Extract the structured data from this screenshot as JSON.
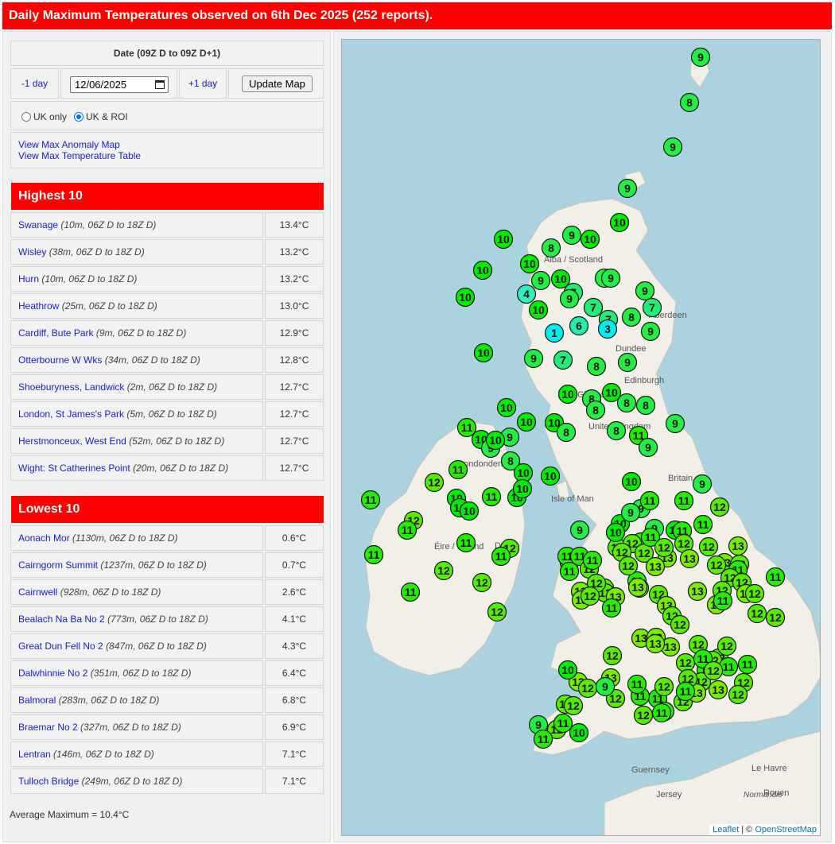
{
  "page_title": "Daily Maximum Temperatures observed on 6th Dec 2025 (252 reports).",
  "controls": {
    "date_header": "Date (09Z D to 09Z D+1)",
    "prev_label": "-1 day",
    "date_value": "12/06/2025",
    "next_label": "+1 day",
    "update_label": "Update Map",
    "uk_only_label": "UK only",
    "uk_roi_label": "UK & ROI",
    "selected_region": "UK & ROI"
  },
  "links": {
    "anomaly": "View Max Anomaly Map",
    "table": "View Max Temperature Table"
  },
  "highest": {
    "title": "Highest 10",
    "rows": [
      {
        "name": "Swanage",
        "detail": "(10m, 06Z D to 18Z D)",
        "value": "13.4°C"
      },
      {
        "name": "Wisley",
        "detail": "(38m, 06Z D to 18Z D)",
        "value": "13.2°C"
      },
      {
        "name": "Hurn",
        "detail": "(10m, 06Z D to 18Z D)",
        "value": "13.2°C"
      },
      {
        "name": "Heathrow",
        "detail": "(25m, 06Z D to 18Z D)",
        "value": "13.0°C"
      },
      {
        "name": "Cardiff, Bute Park",
        "detail": "(9m, 06Z D to 18Z D)",
        "value": "12.9°C"
      },
      {
        "name": "Otterbourne W Wks",
        "detail": "(34m, 06Z D to 18Z D)",
        "value": "12.8°C"
      },
      {
        "name": "Shoeburyness, Landwick",
        "detail": "(2m, 06Z D to 18Z D)",
        "value": "12.7°C"
      },
      {
        "name": "London, St James's Park",
        "detail": "(5m, 06Z D to 18Z D)",
        "value": "12.7°C"
      },
      {
        "name": "Herstmonceux, West End",
        "detail": "(52m, 06Z D to 18Z D)",
        "value": "12.7°C"
      },
      {
        "name": "Wight: St Catherines Point",
        "detail": "(20m, 06Z D to 18Z D)",
        "value": "12.7°C"
      }
    ]
  },
  "lowest": {
    "title": "Lowest 10",
    "rows": [
      {
        "name": "Aonach Mor",
        "detail": "(1130m, 06Z D to 18Z D)",
        "value": "0.6°C"
      },
      {
        "name": "Cairngorm Summit",
        "detail": "(1237m, 06Z D to 18Z D)",
        "value": "0.7°C"
      },
      {
        "name": "Cairnwell",
        "detail": "(928m, 06Z D to 18Z D)",
        "value": "2.6°C"
      },
      {
        "name": "Bealach Na Ba No 2",
        "detail": "(773m, 06Z D to 18Z D)",
        "value": "4.1°C"
      },
      {
        "name": "Great Dun Fell No 2",
        "detail": "(847m, 06Z D to 18Z D)",
        "value": "4.3°C"
      },
      {
        "name": "Dalwhinnie No 2",
        "detail": "(351m, 06Z D to 18Z D)",
        "value": "6.4°C"
      },
      {
        "name": "Balmoral",
        "detail": "(283m, 06Z D to 18Z D)",
        "value": "6.8°C"
      },
      {
        "name": "Braemar No 2",
        "detail": "(327m, 06Z D to 18Z D)",
        "value": "6.9°C"
      },
      {
        "name": "Lentran",
        "detail": "(146m, 06Z D to 18Z D)",
        "value": "7.1°C"
      },
      {
        "name": "Tulloch Bridge",
        "detail": "(249m, 06Z D to 18Z D)",
        "value": "7.1°C"
      }
    ]
  },
  "average": "Average Maximum = 10.4°C",
  "map": {
    "place_labels": [
      "Aberdeen",
      "Dundee",
      "Edinburgh",
      "Glasgow",
      "United Kingdom",
      "Isle of Man",
      "Éire / Ireland",
      "Dublin",
      "Britain",
      "Londonderry",
      "Guernsey",
      "Jersey",
      "Le Havre",
      "Rouen",
      "Normandie",
      "Alba / Scotland"
    ],
    "attribution_leaflet": "Leaflet",
    "attribution_sep": " | © ",
    "attribution_osm": "OpenStreetMap",
    "colors": {
      "sea": "#aad3df",
      "land": "#f2efe9",
      "marker_green": "#00ee00",
      "marker_yellowgreen": "#77ee00",
      "marker_cyan": "#00eeee",
      "marker_teal": "#33eebb"
    },
    "markers": [
      {
        "value": "9",
        "color": "#22ee44"
      },
      {
        "value": "8",
        "color": "#22ee44"
      },
      {
        "value": "9",
        "color": "#22ee44"
      },
      {
        "value": "9",
        "color": "#22ee44"
      },
      {
        "value": "10",
        "color": "#00ee00"
      },
      {
        "value": "10",
        "color": "#00ee00"
      },
      {
        "value": "8",
        "color": "#22ee44"
      },
      {
        "value": "9",
        "color": "#22ee44"
      },
      {
        "value": "10",
        "color": "#00ee00"
      },
      {
        "value": "10",
        "color": "#00ee00"
      },
      {
        "value": "10",
        "color": "#00ee00"
      },
      {
        "value": "10",
        "color": "#00ee00"
      },
      {
        "value": "9",
        "color": "#22ee44"
      },
      {
        "value": "9",
        "color": "#22ee44"
      },
      {
        "value": "4",
        "color": "#33eebb"
      },
      {
        "value": "10",
        "color": "#00ee00"
      },
      {
        "value": "10",
        "color": "#00ee00"
      },
      {
        "value": "9",
        "color": "#22ee44"
      },
      {
        "value": "7",
        "color": "#22ee77"
      },
      {
        "value": "9",
        "color": "#22ee44"
      },
      {
        "value": "9",
        "color": "#22ee44"
      },
      {
        "value": "7",
        "color": "#22ee77"
      },
      {
        "value": "6",
        "color": "#22eeaa"
      },
      {
        "value": "7",
        "color": "#22ee77"
      },
      {
        "value": "7",
        "color": "#22ee77"
      },
      {
        "value": "8",
        "color": "#22ee44"
      },
      {
        "value": "9",
        "color": "#22ee44"
      },
      {
        "value": "8",
        "color": "#22ee44"
      },
      {
        "value": "1",
        "color": "#00eeee"
      },
      {
        "value": "3",
        "color": "#00eeee"
      },
      {
        "value": "10",
        "color": "#00ee00"
      },
      {
        "value": "9",
        "color": "#22ee44"
      },
      {
        "value": "7",
        "color": "#22ee77"
      },
      {
        "value": "8",
        "color": "#22ee44"
      },
      {
        "value": "9",
        "color": "#22ee44"
      },
      {
        "value": "10",
        "color": "#00ee00"
      },
      {
        "value": "8",
        "color": "#22ee44"
      },
      {
        "value": "8",
        "color": "#22ee44"
      },
      {
        "value": "10",
        "color": "#00ee00"
      },
      {
        "value": "8",
        "color": "#22ee44"
      },
      {
        "value": "10",
        "color": "#00ee00"
      },
      {
        "value": "10",
        "color": "#00ee00"
      },
      {
        "value": "10",
        "color": "#00ee00"
      },
      {
        "value": "8",
        "color": "#22ee44"
      },
      {
        "value": "8",
        "color": "#22ee44"
      },
      {
        "value": "11",
        "color": "#22ee00"
      },
      {
        "value": "11",
        "color": "#22ee00"
      },
      {
        "value": "10",
        "color": "#00ee00"
      },
      {
        "value": "9",
        "color": "#22ee44"
      },
      {
        "value": "9",
        "color": "#22ee44"
      },
      {
        "value": "8",
        "color": "#22ee44"
      },
      {
        "value": "9",
        "color": "#22ee44"
      },
      {
        "value": "9",
        "color": "#22ee44"
      },
      {
        "value": "11",
        "color": "#22ee00"
      },
      {
        "value": "10",
        "color": "#00ee00"
      },
      {
        "value": "10",
        "color": "#00ee00"
      },
      {
        "value": "10",
        "color": "#00ee00"
      },
      {
        "value": "12",
        "color": "#55ee00"
      },
      {
        "value": "11",
        "color": "#22ee00"
      },
      {
        "value": "10",
        "color": "#00ee00"
      },
      {
        "value": "10",
        "color": "#00ee00"
      },
      {
        "value": "10",
        "color": "#00ee00"
      },
      {
        "value": "11",
        "color": "#22ee00"
      },
      {
        "value": "10",
        "color": "#00ee00"
      },
      {
        "value": "10",
        "color": "#00ee00"
      },
      {
        "value": "12",
        "color": "#55ee00"
      },
      {
        "value": "11",
        "color": "#22ee00"
      },
      {
        "value": "11",
        "color": "#22ee00"
      },
      {
        "value": "11",
        "color": "#22ee00"
      },
      {
        "value": "12",
        "color": "#55ee00"
      },
      {
        "value": "11",
        "color": "#22ee00"
      },
      {
        "value": "12",
        "color": "#55ee00"
      },
      {
        "value": "12",
        "color": "#55ee00"
      },
      {
        "value": "11",
        "color": "#22ee00"
      },
      {
        "value": "12",
        "color": "#55ee00"
      },
      {
        "value": "11",
        "color": "#22ee00"
      },
      {
        "value": "12",
        "color": "#55ee00"
      },
      {
        "value": "13",
        "color": "#77ee00"
      },
      {
        "value": "10",
        "color": "#00ee00"
      },
      {
        "value": "9",
        "color": "#22ee44"
      },
      {
        "value": "10",
        "color": "#00ee00"
      },
      {
        "value": "9",
        "color": "#22ee44"
      },
      {
        "value": "9",
        "color": "#22ee44"
      },
      {
        "value": "9",
        "color": "#22ee44"
      },
      {
        "value": "10",
        "color": "#00ee00"
      },
      {
        "value": "9",
        "color": "#22ee44"
      },
      {
        "value": "11",
        "color": "#22ee00"
      },
      {
        "value": "11",
        "color": "#22ee00"
      },
      {
        "value": "10",
        "color": "#00ee00"
      },
      {
        "value": "11",
        "color": "#22ee00"
      },
      {
        "value": "11",
        "color": "#22ee00"
      },
      {
        "value": "12",
        "color": "#55ee00"
      },
      {
        "value": "12",
        "color": "#55ee00"
      },
      {
        "value": "11",
        "color": "#22ee00"
      },
      {
        "value": "11",
        "color": "#22ee00"
      },
      {
        "value": "12",
        "color": "#55ee00"
      },
      {
        "value": "12",
        "color": "#55ee00"
      },
      {
        "value": "11",
        "color": "#22ee00"
      },
      {
        "value": "12",
        "color": "#55ee00"
      },
      {
        "value": "12",
        "color": "#55ee00"
      },
      {
        "value": "12",
        "color": "#55ee00"
      },
      {
        "value": "11",
        "color": "#22ee00"
      },
      {
        "value": "11",
        "color": "#22ee00"
      },
      {
        "value": "11",
        "color": "#22ee00"
      },
      {
        "value": "12",
        "color": "#55ee00"
      },
      {
        "value": "12",
        "color": "#55ee00"
      },
      {
        "value": "13",
        "color": "#77ee00"
      },
      {
        "value": "12",
        "color": "#55ee00"
      },
      {
        "value": "12",
        "color": "#55ee00"
      },
      {
        "value": "13",
        "color": "#77ee00"
      },
      {
        "value": "13",
        "color": "#77ee00"
      },
      {
        "value": "12",
        "color": "#55ee00"
      },
      {
        "value": "13",
        "color": "#77ee00"
      },
      {
        "value": "12",
        "color": "#55ee00"
      },
      {
        "value": "13",
        "color": "#77ee00"
      },
      {
        "value": "13",
        "color": "#77ee00"
      },
      {
        "value": "12",
        "color": "#55ee00"
      },
      {
        "value": "12",
        "color": "#55ee00"
      },
      {
        "value": "11",
        "color": "#22ee00"
      },
      {
        "value": "11",
        "color": "#22ee00"
      },
      {
        "value": "12",
        "color": "#55ee00"
      },
      {
        "value": "13",
        "color": "#77ee00"
      },
      {
        "value": "11",
        "color": "#22ee00"
      },
      {
        "value": "12",
        "color": "#55ee00"
      },
      {
        "value": "13",
        "color": "#77ee00"
      },
      {
        "value": "13",
        "color": "#77ee00"
      },
      {
        "value": "12",
        "color": "#55ee00"
      },
      {
        "value": "12",
        "color": "#55ee00"
      },
      {
        "value": "13",
        "color": "#77ee00"
      },
      {
        "value": "13",
        "color": "#77ee00"
      },
      {
        "value": "13",
        "color": "#77ee00"
      },
      {
        "value": "13",
        "color": "#77ee00"
      },
      {
        "value": "13",
        "color": "#77ee00"
      },
      {
        "value": "12",
        "color": "#55ee00"
      },
      {
        "value": "12",
        "color": "#55ee00"
      },
      {
        "value": "11",
        "color": "#22ee00"
      },
      {
        "value": "12",
        "color": "#55ee00"
      },
      {
        "value": "11",
        "color": "#22ee00"
      },
      {
        "value": "12",
        "color": "#55ee00"
      },
      {
        "value": "12",
        "color": "#55ee00"
      },
      {
        "value": "12",
        "color": "#55ee00"
      },
      {
        "value": "13",
        "color": "#77ee00"
      },
      {
        "value": "13",
        "color": "#77ee00"
      },
      {
        "value": "12",
        "color": "#55ee00"
      },
      {
        "value": "11",
        "color": "#22ee00"
      },
      {
        "value": "12",
        "color": "#55ee00"
      },
      {
        "value": "12",
        "color": "#55ee00"
      },
      {
        "value": "11",
        "color": "#22ee00"
      },
      {
        "value": "12",
        "color": "#55ee00"
      },
      {
        "value": "11",
        "color": "#22ee00"
      },
      {
        "value": "12",
        "color": "#55ee00"
      },
      {
        "value": "12",
        "color": "#55ee00"
      },
      {
        "value": "12",
        "color": "#55ee00"
      },
      {
        "value": "11",
        "color": "#22ee00"
      },
      {
        "value": "11",
        "color": "#22ee00"
      },
      {
        "value": "12",
        "color": "#55ee00"
      },
      {
        "value": "13",
        "color": "#77ee00"
      },
      {
        "value": "13",
        "color": "#77ee00"
      },
      {
        "value": "12",
        "color": "#55ee00"
      },
      {
        "value": "12",
        "color": "#55ee00"
      },
      {
        "value": "12",
        "color": "#55ee00"
      },
      {
        "value": "11",
        "color": "#22ee00"
      },
      {
        "value": "12",
        "color": "#55ee00"
      },
      {
        "value": "11",
        "color": "#22ee00"
      },
      {
        "value": "12",
        "color": "#55ee00"
      },
      {
        "value": "12",
        "color": "#55ee00"
      },
      {
        "value": "13",
        "color": "#77ee00"
      },
      {
        "value": "13",
        "color": "#77ee00"
      },
      {
        "value": "12",
        "color": "#55ee00"
      },
      {
        "value": "12",
        "color": "#55ee00"
      },
      {
        "value": "11",
        "color": "#22ee00"
      },
      {
        "value": "11",
        "color": "#22ee00"
      },
      {
        "value": "12",
        "color": "#55ee00"
      },
      {
        "value": "11",
        "color": "#22ee00"
      },
      {
        "value": "9",
        "color": "#22ee44"
      },
      {
        "value": "10",
        "color": "#00ee00"
      },
      {
        "value": "10",
        "color": "#00ee00"
      },
      {
        "value": "9",
        "color": "#22ee44"
      },
      {
        "value": "12",
        "color": "#55ee00"
      },
      {
        "value": "12",
        "color": "#55ee00"
      },
      {
        "value": "11",
        "color": "#22ee00"
      },
      {
        "value": "11",
        "color": "#22ee00"
      }
    ]
  }
}
